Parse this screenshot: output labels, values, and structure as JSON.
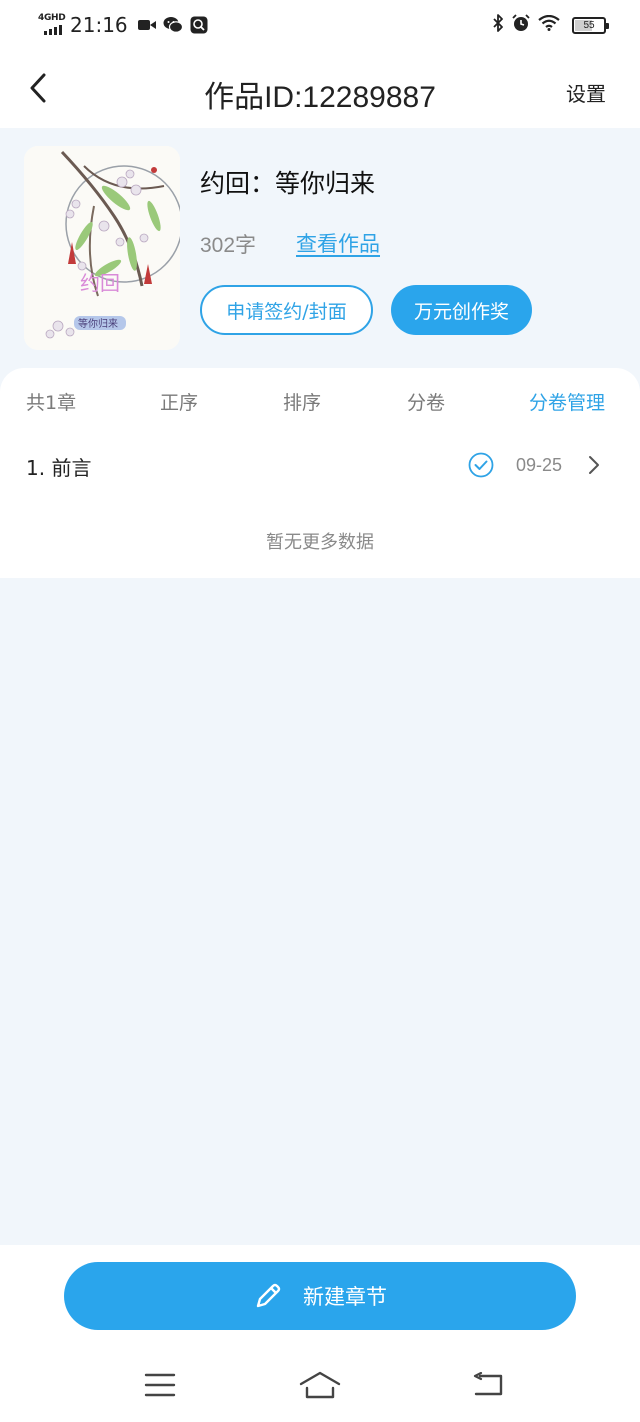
{
  "status_bar": {
    "network": "4GHD",
    "time": "21:16",
    "battery": "55",
    "icons": [
      "video-icon",
      "wechat-icon",
      "search-app-icon",
      "bluetooth-icon",
      "alarm-icon",
      "wifi-icon",
      "battery-icon"
    ]
  },
  "header": {
    "title": "作品ID:12289887",
    "settings_label": "设置",
    "back_icon": "chevron-left-icon"
  },
  "work": {
    "title": "约回：等你归来",
    "word_count": "302字",
    "view_link": "查看作品",
    "apply_button": "申请签约/封面",
    "award_button": "万元创作奖",
    "cover": {
      "text_main": "约回",
      "text_sub": "等你归来"
    }
  },
  "tabs": [
    {
      "label": "共1章",
      "active": false
    },
    {
      "label": "正序",
      "active": false
    },
    {
      "label": "排序",
      "active": false
    },
    {
      "label": "分卷",
      "active": false
    },
    {
      "label": "分卷管理",
      "active": true
    }
  ],
  "chapters": [
    {
      "title": "1. 前言",
      "date": "09-25",
      "status_icon": "check-circle-icon"
    }
  ],
  "no_more_text": "暂无更多数据",
  "new_chapter_button": "新建章节",
  "colors": {
    "accent": "#2aa5ec",
    "background": "#f1f6fb",
    "muted_text": "#8a8a8a"
  },
  "nav_icons": [
    "menu-icon",
    "home-icon",
    "back-icon"
  ]
}
